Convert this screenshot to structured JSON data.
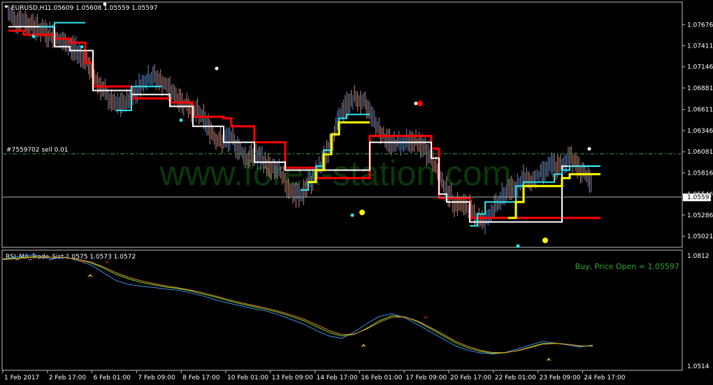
{
  "header": {
    "title": "EURUSD,H1",
    "ohlc": "1.05609 1.05608 1.05559 1.05597"
  },
  "order_label": "#7559702 sell 0.01",
  "watermark": "www.forex-station.com",
  "price_axis": {
    "ticks": [
      "1.07676",
      "1.07411",
      "1.07146",
      "1.06881",
      "1.06611",
      "1.06346",
      "1.06081",
      "1.05816",
      "1.05546",
      "1.05286",
      "1.05021"
    ],
    "current_price": "1.05597"
  },
  "indicator": {
    "title": "RSI_MA_Trade_Sist 1.0575 1.0573 1.0572",
    "axis_top": "1.0812",
    "axis_bottom": "1.0514",
    "status_text": "Buy, Price Open = 1.05597"
  },
  "time_axis": {
    "labels": [
      "1 Feb 2017",
      "2 Feb 17:00",
      "6 Feb 01:00",
      "7 Feb 09:00",
      "8 Feb 17:00",
      "10 Feb 01:00",
      "13 Feb 09:00",
      "14 Feb 17:00",
      "16 Feb 01:00",
      "17 Feb 09:00",
      "20 Feb 17:00",
      "22 Feb 01:00",
      "23 Feb 09:00",
      "24 Feb 17:00"
    ]
  },
  "colors": {
    "background": "#000000",
    "bear_bars": "#c8877a",
    "bull_bars": "#5b8fd0",
    "red_line": "#ff0000",
    "white_line": "#ffffff",
    "cyan_line": "#2fe6f0",
    "yellow_line": "#ffff00",
    "order_line": "#3fa34a",
    "status_text": "#2fa82f",
    "indicator_blue": "#3d8ee8",
    "indicator_green": "#7fd03a",
    "indicator_orange": "#e08a20"
  },
  "chart_data": {
    "type": "line",
    "title": "EURUSD,H1",
    "x_labels": [
      "1 Feb 2017",
      "2 Feb 17:00",
      "6 Feb 01:00",
      "7 Feb 09:00",
      "8 Feb 17:00",
      "10 Feb 01:00",
      "13 Feb 09:00",
      "14 Feb 17:00",
      "16 Feb 01:00",
      "17 Feb 09:00",
      "20 Feb 17:00",
      "22 Feb 01:00",
      "23 Feb 09:00",
      "24 Feb 17:00"
    ],
    "ylim": [
      1.0489,
      1.0795
    ],
    "order_level": 1.0608,
    "current_level": 1.05597,
    "price": [
      1.078,
      1.0775,
      1.0772,
      1.0768,
      1.0762,
      1.0757,
      1.0752,
      1.0745,
      1.074,
      1.0735,
      1.0722,
      1.0706,
      1.069,
      1.0675,
      1.0665,
      1.0668,
      1.0678,
      1.069,
      1.07,
      1.0702,
      1.0695,
      1.0685,
      1.0675,
      1.0668,
      1.066,
      1.0655,
      1.064,
      1.0625,
      1.062,
      1.0625,
      1.0612,
      1.06,
      1.0603,
      1.0598,
      1.0588,
      1.0585,
      1.057,
      1.0555,
      1.0553,
      1.0565,
      1.058,
      1.0598,
      1.062,
      1.065,
      1.0668,
      1.0675,
      1.067,
      1.0662,
      1.064,
      1.0625,
      1.0618,
      1.062,
      1.0622,
      1.062,
      1.0613,
      1.06,
      1.058,
      1.056,
      1.0545,
      1.054,
      1.0538,
      1.0525,
      1.052,
      1.0535,
      1.0548,
      1.056,
      1.0565,
      1.0575,
      1.0572,
      1.0578,
      1.0588,
      1.059,
      1.0588,
      1.0605,
      1.059,
      1.058,
      1.056
    ],
    "series": [
      {
        "color": "#ff0000",
        "values": [
          1.076,
          1.076,
          1.0755,
          1.0755,
          1.0755,
          1.0755,
          1.075,
          1.075,
          1.0745,
          1.0745,
          1.072,
          1.069,
          1.069,
          1.069,
          1.069,
          1.069,
          1.0675,
          1.0675,
          1.0675,
          1.0675,
          1.0675,
          1.067,
          1.067,
          1.067,
          1.0652,
          1.0652,
          1.0652,
          1.0652,
          1.065,
          1.064,
          1.064,
          1.064,
          1.062,
          1.062,
          1.062,
          1.062,
          1.0588,
          1.0588,
          1.0588,
          1.0588,
          1.0575,
          1.0575,
          1.0575,
          1.0575,
          1.0575,
          1.0575,
          1.0575,
          1.0628,
          1.0628,
          1.0628,
          1.0628,
          1.0628,
          1.0628,
          1.0628,
          1.0628,
          1.0612,
          1.055,
          1.055,
          1.055,
          1.055,
          1.0525,
          1.0525,
          1.0525,
          1.0525,
          1.0525,
          1.0525,
          1.0525,
          1.0525,
          1.0525,
          1.0525,
          1.0525,
          1.0525,
          1.0525,
          1.0525,
          1.0525,
          1.0525,
          1.0525
        ]
      },
      {
        "color": "#ffffff",
        "values": [
          1.0765,
          1.0765,
          1.0765,
          1.0765,
          1.0765,
          1.0765,
          1.074,
          1.074,
          1.0735,
          1.0735,
          1.0735,
          1.0685,
          1.0685,
          1.0685,
          1.0685,
          1.0685,
          1.068,
          1.068,
          1.068,
          1.068,
          1.068,
          1.0665,
          1.0665,
          1.0665,
          1.064,
          1.064,
          1.064,
          1.064,
          1.062,
          1.062,
          1.062,
          1.062,
          1.0595,
          1.0595,
          1.0595,
          1.0595,
          1.0585,
          1.0585,
          1.0585,
          1.0585,
          1.0585,
          1.0585,
          1.0585,
          1.0585,
          1.0585,
          1.0585,
          1.0585,
          1.062,
          1.062,
          1.062,
          1.062,
          1.062,
          1.062,
          1.062,
          1.062,
          1.06,
          1.0555,
          1.0545,
          1.0545,
          1.0545,
          1.052,
          1.052,
          1.052,
          1.052,
          1.052,
          1.052,
          1.052,
          1.052,
          1.052,
          1.052,
          1.052,
          1.052,
          1.059,
          1.059,
          1.059,
          1.059,
          1.059
        ]
      },
      {
        "color": "#2fe6f0",
        "values": [
          null,
          null,
          null,
          null,
          1.0765,
          1.0765,
          1.077,
          1.077,
          1.077,
          1.077,
          null,
          null,
          null,
          null,
          1.066,
          1.066,
          1.069,
          1.069,
          1.069,
          1.069,
          null,
          null,
          null,
          null,
          null,
          null,
          null,
          null,
          null,
          null,
          null,
          null,
          null,
          null,
          null,
          null,
          null,
          null,
          1.056,
          1.057,
          1.059,
          1.061,
          1.063,
          1.065,
          1.0655,
          1.0655,
          1.0655,
          null,
          null,
          null,
          null,
          null,
          null,
          null,
          null,
          null,
          null,
          null,
          null,
          null,
          1.0515,
          1.053,
          1.0545,
          1.0545,
          1.0545,
          1.0545,
          1.0565,
          1.057,
          1.057,
          1.057,
          1.057,
          1.058,
          1.0585,
          1.059,
          1.059,
          1.059,
          1.059
        ]
      },
      {
        "color": "#ffff00",
        "values": [
          null,
          null,
          null,
          null,
          null,
          null,
          null,
          null,
          null,
          null,
          null,
          null,
          null,
          null,
          null,
          null,
          null,
          null,
          null,
          null,
          null,
          null,
          null,
          null,
          null,
          null,
          null,
          null,
          null,
          null,
          null,
          null,
          null,
          null,
          null,
          null,
          null,
          null,
          null,
          1.057,
          1.0585,
          1.0605,
          1.063,
          1.0645,
          1.0645,
          1.0645,
          1.0645,
          null,
          null,
          null,
          null,
          null,
          null,
          null,
          null,
          null,
          null,
          null,
          null,
          null,
          null,
          null,
          null,
          null,
          null,
          1.0525,
          1.0545,
          1.0565,
          1.0565,
          1.0565,
          1.0565,
          1.0565,
          1.0575,
          1.058,
          1.058,
          1.058,
          1.058
        ]
      }
    ],
    "indicator": {
      "title": "RSI_MA_Trade_Sist 1.0575 1.0573 1.0572",
      "ylim": [
        1.0514,
        1.0812
      ],
      "series": [
        {
          "color": "#3d8ee8",
          "values": [
            1.0795,
            1.08,
            1.0805,
            1.08,
            1.0795,
            1.08,
            1.079,
            1.078,
            1.076,
            1.074,
            1.073,
            1.0725,
            1.0722,
            1.0718,
            1.0715,
            1.0708,
            1.07,
            1.069,
            1.0682,
            1.0675,
            1.0668,
            1.0662,
            1.0652,
            1.064,
            1.0628,
            1.0612,
            1.0598,
            1.0592,
            1.0608,
            1.063,
            1.0648,
            1.0655,
            1.0645,
            1.0628,
            1.061,
            1.0592,
            1.0574,
            1.0562,
            1.0555,
            1.0552,
            1.0556,
            1.0565,
            1.0575,
            1.0584,
            1.058,
            1.0575,
            1.057,
            1.0575
          ]
        },
        {
          "color": "#7fd03a",
          "values": [
            1.0795,
            1.0797,
            1.08,
            1.0801,
            1.0799,
            1.0798,
            1.0793,
            1.0785,
            1.0772,
            1.0756,
            1.0744,
            1.0735,
            1.0729,
            1.0723,
            1.0719,
            1.0713,
            1.0705,
            1.0697,
            1.0688,
            1.068,
            1.0673,
            1.0666,
            1.0658,
            1.0648,
            1.0637,
            1.0622,
            1.0607,
            1.0598,
            1.0602,
            1.0618,
            1.0637,
            1.065,
            1.0647,
            1.0635,
            1.0618,
            1.06,
            1.0582,
            1.0568,
            1.0559,
            1.0554,
            1.0555,
            1.0561,
            1.057,
            1.0579,
            1.058,
            1.0577,
            1.0572,
            1.0573
          ]
        },
        {
          "color": "#e08a20",
          "values": [
            1.0793,
            1.0795,
            1.0798,
            1.08,
            1.0799,
            1.0798,
            1.0794,
            1.0787,
            1.0775,
            1.076,
            1.0748,
            1.0739,
            1.0732,
            1.0726,
            1.0721,
            1.0715,
            1.0708,
            1.07,
            1.0691,
            1.0683,
            1.0676,
            1.0669,
            1.0661,
            1.0652,
            1.0641,
            1.0627,
            1.0612,
            1.0602,
            1.0603,
            1.0616,
            1.0633,
            1.0646,
            1.0647,
            1.0637,
            1.0621,
            1.0604,
            1.0586,
            1.0572,
            1.0562,
            1.0556,
            1.0556,
            1.056,
            1.0568,
            1.0577,
            1.0579,
            1.0577,
            1.0573,
            1.0572
          ]
        }
      ]
    }
  }
}
